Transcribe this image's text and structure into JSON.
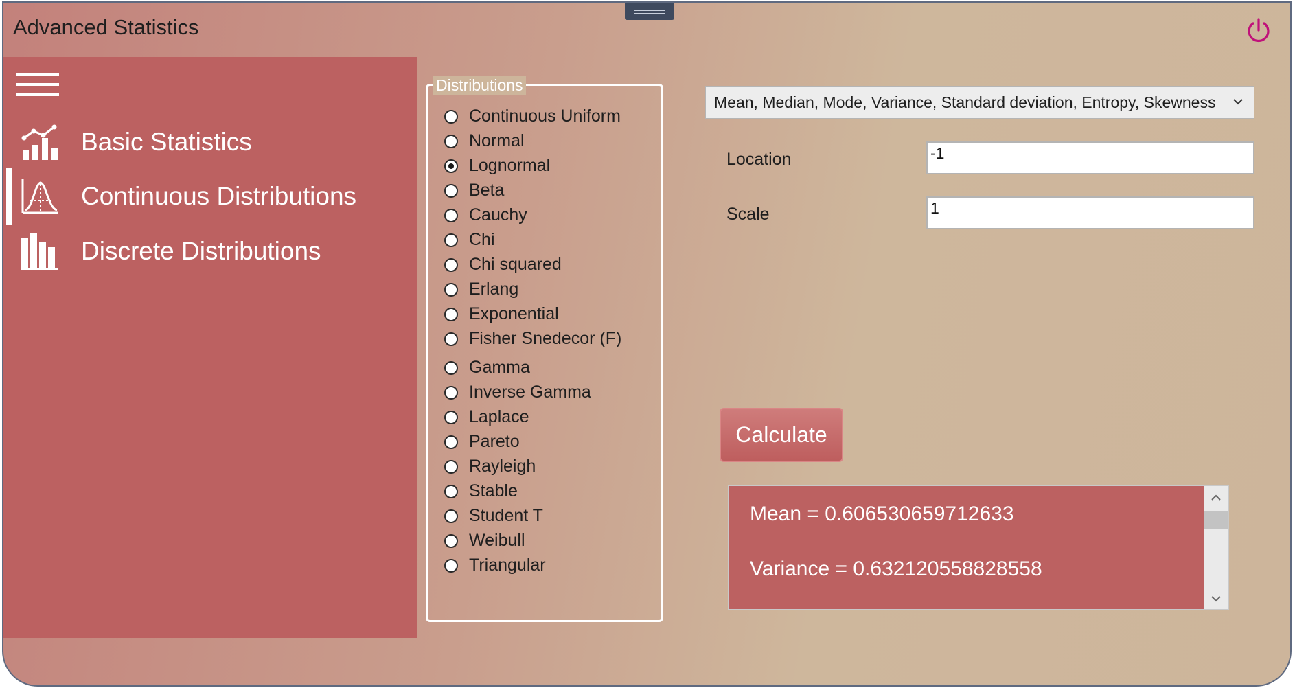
{
  "app": {
    "title": "Advanced Statistics"
  },
  "sidebar": {
    "items": [
      {
        "label": "Basic Statistics",
        "icon": "chart-bars-line-icon"
      },
      {
        "label": "Continuous Distributions",
        "icon": "bell-curve-icon",
        "selected": true
      },
      {
        "label": "Discrete Distributions",
        "icon": "bar-chart-icon"
      }
    ]
  },
  "distributions": {
    "legend": "Distributions",
    "selected": "Lognormal",
    "options": [
      "Continuous Uniform",
      "Normal",
      "Lognormal",
      "Beta",
      "Cauchy",
      "Chi",
      "Chi squared",
      "Erlang",
      "Exponential",
      "Fisher Snedecor (F)",
      "Gamma",
      "Inverse Gamma",
      "Laplace",
      "Pareto",
      "Rayleigh",
      "Stable",
      "Student T",
      "Weibull",
      "Triangular"
    ]
  },
  "stats_select": {
    "value": "Mean, Median, Mode, Variance, Standard deviation, Entropy, Skewness"
  },
  "params": {
    "location": {
      "label": "Location",
      "value": "-1"
    },
    "scale": {
      "label": "Scale",
      "value": "1"
    }
  },
  "actions": {
    "calculate_label": "Calculate"
  },
  "results": {
    "lines": [
      "Mean = 0.606530659712633",
      "Variance = 0.632120558828558"
    ]
  },
  "colors": {
    "sidebar": "#bc6161",
    "power_icon": "#c0127a",
    "accent": "#cdb59b"
  }
}
